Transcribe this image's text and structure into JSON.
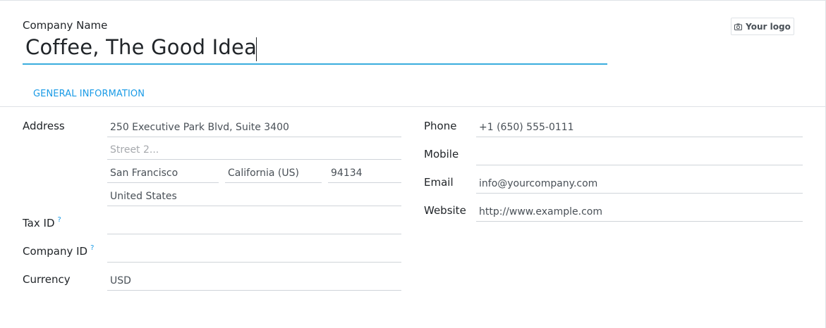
{
  "form": {
    "company_name_label": "Company Name",
    "company_name_value": "Coffee, The Good Idea",
    "logo_button_label": "Your logo",
    "tab_label": "GENERAL INFORMATION"
  },
  "address": {
    "label": "Address",
    "street": "250 Executive Park Blvd, Suite 3400",
    "street2_value": "",
    "street2_placeholder": "Street 2...",
    "city": "San Francisco",
    "state": "California (US)",
    "zip": "94134",
    "country": "United States"
  },
  "tax_id": {
    "label": "Tax ID",
    "help": "?",
    "value": ""
  },
  "company_id": {
    "label": "Company ID",
    "help": "?",
    "value": ""
  },
  "currency": {
    "label": "Currency",
    "value": "USD"
  },
  "contact": {
    "phone_label": "Phone",
    "phone_value": "+1 (650) 555-0111",
    "mobile_label": "Mobile",
    "mobile_value": "",
    "email_label": "Email",
    "email_value": "info@yourcompany.com",
    "website_label": "Website",
    "website_value": "http://www.example.com"
  },
  "colors": {
    "accent": "#1a9be6",
    "input_focus_border": "#3aadde",
    "field_border": "#cfd4d9"
  }
}
